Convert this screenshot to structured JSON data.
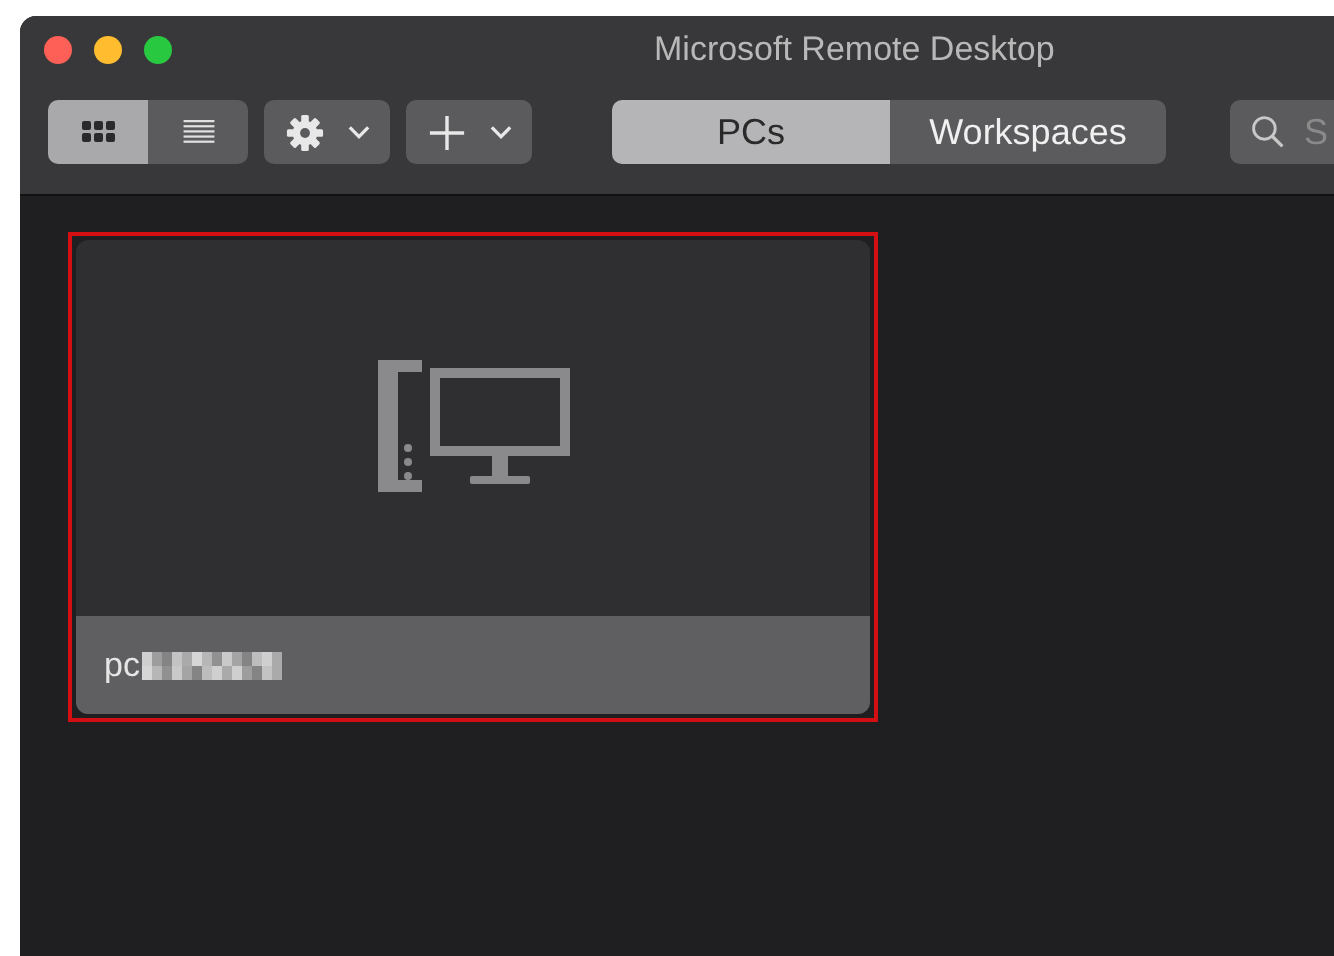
{
  "window": {
    "title": "Microsoft Remote Desktop"
  },
  "view_modes": [
    {
      "kind": "grid",
      "selected": true
    },
    {
      "kind": "list",
      "selected": false
    }
  ],
  "toolbar_menus": [
    {
      "kind": "gear"
    },
    {
      "kind": "plus"
    }
  ],
  "tabs": [
    {
      "label": "PCs",
      "selected": true
    },
    {
      "label": "Workspaces",
      "selected": false
    }
  ],
  "search": {
    "placeholder": "S"
  },
  "pcs": [
    {
      "name": "pc",
      "selected": true,
      "redacted": true
    }
  ]
}
